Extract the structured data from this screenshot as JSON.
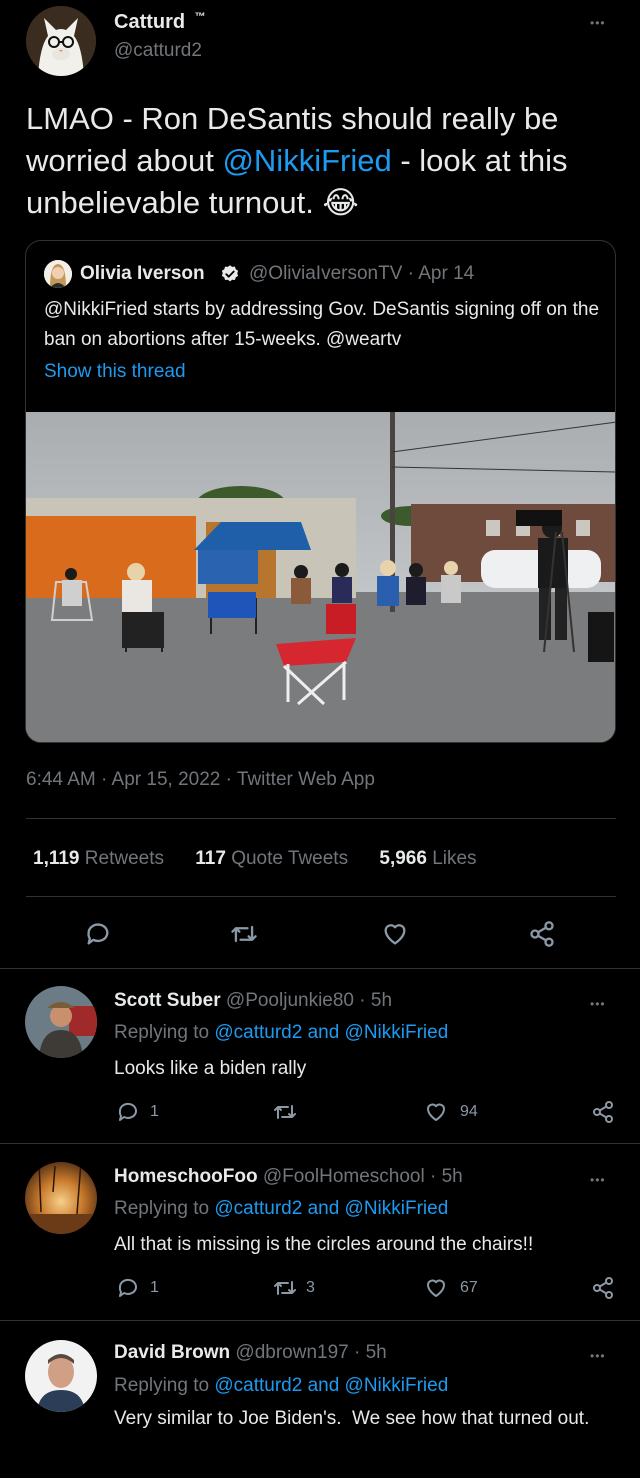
{
  "main_tweet": {
    "author": {
      "name": "Catturd",
      "badge": "™",
      "handle": "@catturd2",
      "avatar_icon": "cat-avatar-icon"
    },
    "text_before": "LMAO - Ron DeSantis should really be worried about ",
    "mention": "@NikkiFried",
    "text_after": " - look at this unbelievable turnout. ",
    "emoji": "😂",
    "quoted": {
      "name": "Olivia Iverson",
      "handle": "@OliviaIversonTV",
      "date": "· Apr 14",
      "text": "@NikkiFried starts by addressing Gov. DeSantis signing off on the ban on abortions after 15-weeks. @weartv",
      "show_thread": "Show this thread",
      "verified_icon": "verified-badge-icon"
    },
    "timestamp": "6:44 AM · Apr 15, 2022 · Twitter Web App",
    "stats": {
      "retweets": "1,119",
      "retweets_label": "Retweets",
      "quotes": "117",
      "quotes_label": "Quote Tweets",
      "likes": "5,966",
      "likes_label": "Likes"
    }
  },
  "replies": [
    {
      "name": "Scott Suber",
      "handle": "@Pooljunkie80",
      "time": "· 5h",
      "replying_prefix": "Replying to ",
      "replying_users": "@catturd2 and @NikkiFried",
      "text": "Looks like a biden rally",
      "reply_count": "1",
      "retweet_count": "",
      "like_count": "94"
    },
    {
      "name": "HomeschooFoo",
      "handle": "@FoolHomeschool",
      "time": "· 5h",
      "replying_prefix": "Replying to ",
      "replying_users": "@catturd2 and @NikkiFried",
      "text": "All that is missing is the circles around the chairs!!",
      "reply_count": "1",
      "retweet_count": "3",
      "like_count": "67"
    },
    {
      "name": "David Brown",
      "handle": "@dbrown197",
      "time": "· 5h",
      "replying_prefix": "Replying to ",
      "replying_users": "@catturd2 and @NikkiFried",
      "text": "Very similar to Joe Biden's.  We see how that turned out.",
      "reply_count": "",
      "retweet_count": "",
      "like_count": ""
    }
  ],
  "more_label": "•••",
  "colors": {
    "background": "#000000",
    "text": "#e7e9ea",
    "muted": "#71767b",
    "link": "#1d9bf0",
    "divider": "#2f3336"
  }
}
